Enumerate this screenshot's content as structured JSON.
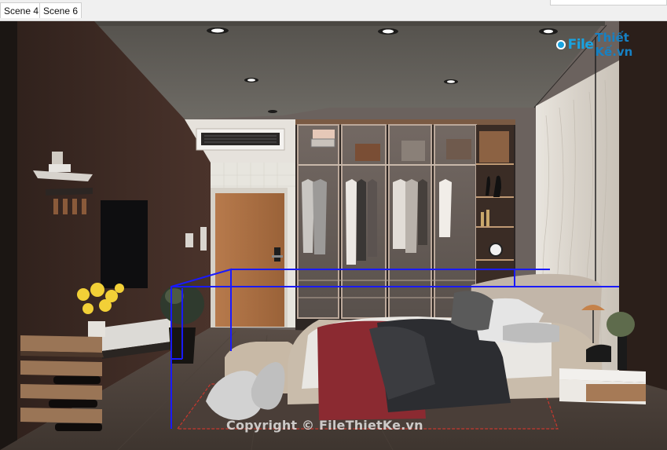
{
  "tabs": [
    {
      "label": "Scene 4"
    },
    {
      "label": "Scene 6"
    }
  ],
  "logo": {
    "part1": "File",
    "part2": "Thiết Kế.vn"
  },
  "watermark": {
    "text": "Copyright © FileThietKe.vn"
  },
  "viewport": {
    "scene": "3D bedroom interior model"
  },
  "colors": {
    "selection_lines": "#1a1aff",
    "bed_runner": "#8b2a31",
    "wall_left": "#3d2a24",
    "tab_bar": "#f0f0f0"
  }
}
